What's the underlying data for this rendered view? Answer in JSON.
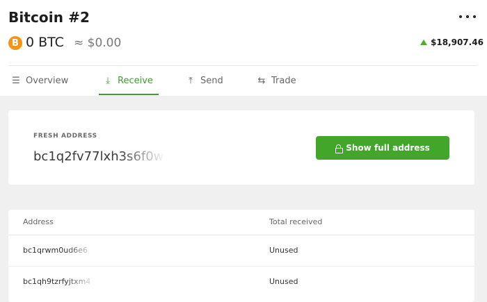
{
  "account": {
    "title": "Bitcoin #2",
    "balance": "0 BTC",
    "fiat_balance": "≈ $0.00",
    "price": "$18,907.46",
    "price_trend": "up",
    "coin_logo": "B"
  },
  "tabs": [
    {
      "label": "Overview",
      "icon": "list-icon",
      "icon_glyph": "☰",
      "active": false
    },
    {
      "label": "Receive",
      "icon": "download-arrow-icon",
      "icon_glyph": "⤓",
      "active": true
    },
    {
      "label": "Send",
      "icon": "upload-arrow-icon",
      "icon_glyph": "⤒",
      "active": false
    },
    {
      "label": "Trade",
      "icon": "swap-icon",
      "icon_glyph": "⇆",
      "active": false
    }
  ],
  "fresh_address": {
    "label": "FRESH ADDRESS",
    "value": "bc1q2fv77lxh3s6f0w",
    "button_label": "Show full address"
  },
  "addresses_table": {
    "columns": [
      "Address",
      "Total received"
    ],
    "rows": [
      {
        "address": "bc1qrwm0ud6e6",
        "total": "Unused"
      },
      {
        "address": "bc1qh9tzrfyjtxm4",
        "total": "Unused"
      }
    ]
  },
  "colors": {
    "accent": "#41a62a",
    "bitcoin": "#f7931a",
    "trend_up": "#4caf2e"
  }
}
